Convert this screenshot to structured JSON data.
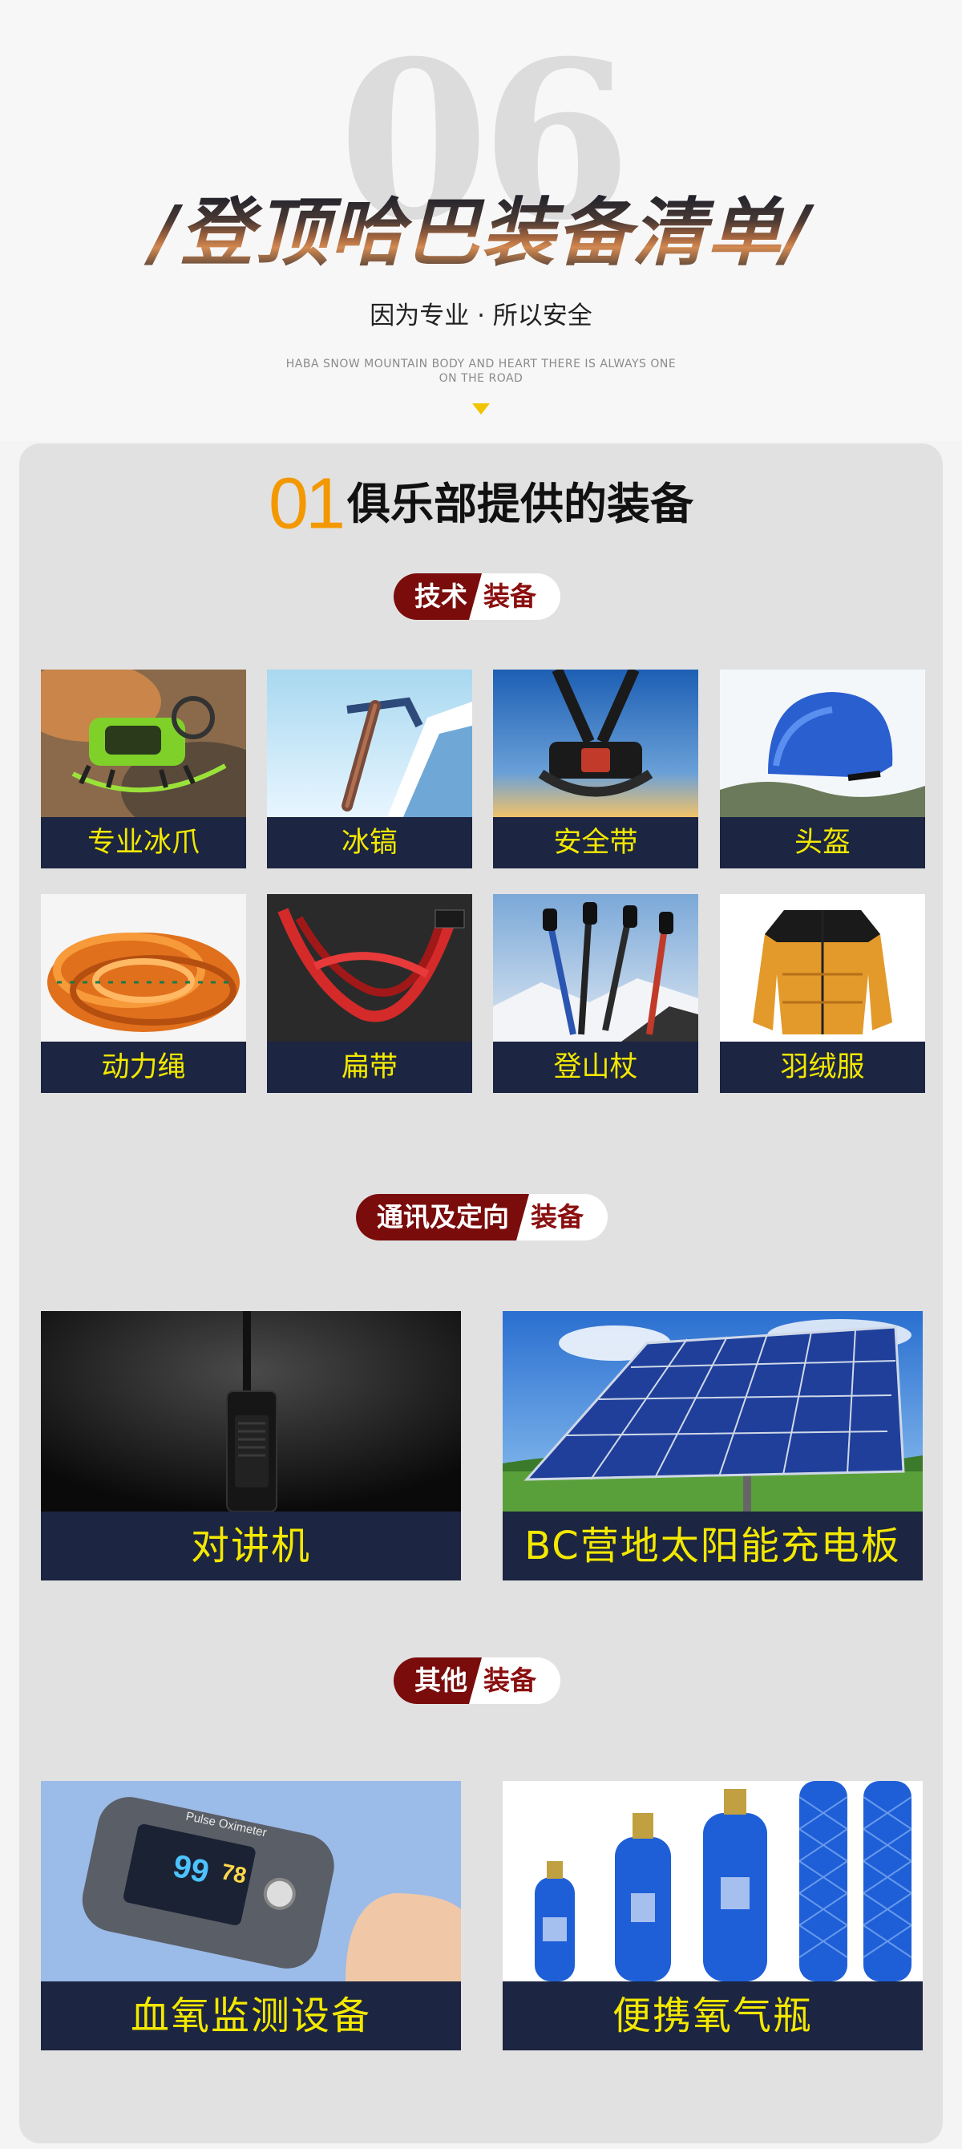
{
  "header": {
    "big_number": "06",
    "title": "/登顶哈巴装备清单/",
    "subtitle": "因为专业 · 所以安全",
    "tagline_line1": "HABA SNOW MOUNTAIN BODY AND HEART THERE IS ALWAYS ONE",
    "tagline_line2": "ON THE ROAD",
    "accent_color": "#f0c400"
  },
  "section": {
    "number": "01",
    "title": "俱乐部提供的装备",
    "number_color": "#f39800"
  },
  "groups": [
    {
      "tag_main": "技术",
      "tag_suffix": "装备",
      "items": [
        {
          "label": "专业冰爪",
          "icon": "crampon-image"
        },
        {
          "label": "冰镐",
          "icon": "ice-axe-image"
        },
        {
          "label": "安全带",
          "icon": "harness-image"
        },
        {
          "label": "头盔",
          "icon": "helmet-image"
        },
        {
          "label": "动力绳",
          "icon": "rope-image"
        },
        {
          "label": "扁带",
          "icon": "sling-image"
        },
        {
          "label": "登山杖",
          "icon": "trekking-pole-image"
        },
        {
          "label": "羽绒服",
          "icon": "down-jacket-image"
        }
      ]
    },
    {
      "tag_main": "通讯及定向",
      "tag_suffix": "装备",
      "items": [
        {
          "label": "对讲机",
          "icon": "walkie-talkie-image"
        },
        {
          "label": "BC营地太阳能充电板",
          "icon": "solar-panel-image"
        }
      ]
    },
    {
      "tag_main": "其他",
      "tag_suffix": "装备",
      "items": [
        {
          "label": "血氧监测设备",
          "icon": "pulse-oximeter-image"
        },
        {
          "label": "便携氧气瓶",
          "icon": "oxygen-bottle-image"
        }
      ]
    }
  ],
  "images_text": {
    "oximeter_brand": "Pulse Oximeter",
    "oximeter_spo2": "99",
    "oximeter_pr": "78"
  },
  "colors": {
    "label_bg": "#1c2541",
    "label_text": "#f3e800",
    "tag_dark": "#7a0c0c",
    "panel_bg": "#e1e1e1"
  }
}
